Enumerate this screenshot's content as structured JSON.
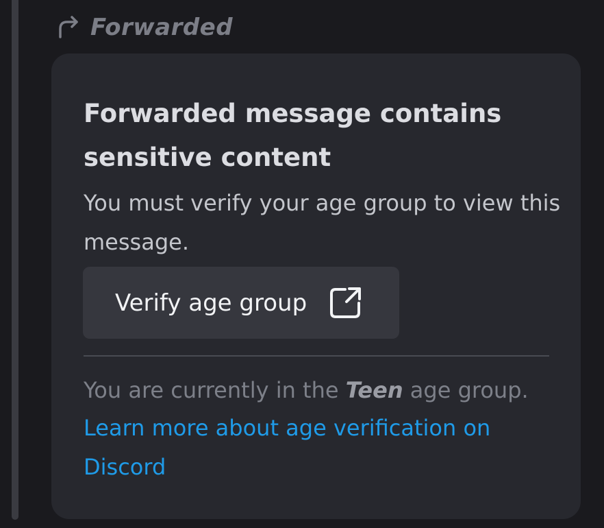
{
  "forward": {
    "label": "Forwarded",
    "icon": "forward-arrow-icon"
  },
  "card": {
    "title": "Forwarded message contains sensitive content",
    "body": "You must verify your age group to view this message.",
    "button_label": "Verify age group",
    "button_icon": "external-link-icon",
    "status_prefix": "You are currently in the ",
    "status_group": "Teen",
    "status_suffix": " age group.",
    "learn_more_link": "Learn more about age verification on Discord"
  },
  "colors": {
    "background": "#1a1a1e",
    "card": "#27282e",
    "button": "#36373e",
    "link": "#1f9be8",
    "muted_text": "#7d8089"
  }
}
